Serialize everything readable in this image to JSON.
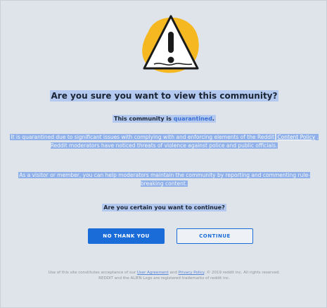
{
  "warning": {
    "icon": "warning-triangle-icon",
    "colors": {
      "blob": "#f5b820",
      "triangle_fill": "#ffffff",
      "mark": "#1a1a1a"
    }
  },
  "dialog": {
    "title": "Are you sure you want to view this community?",
    "subtitle_prefix": "This community is",
    "subtitle_status": "quarantined",
    "subtitle_suffix": ".",
    "para1_start": "It is quarantined due to significant issues with complying with and enforcing elements of the Reddit",
    "para1_link": "Content Policy",
    "para1_end": ". Reddit moderators have noticed threats of violence against police and public officials.",
    "para2": "As a visitor or member, you can help moderators maintain the community by reporting and commenting rule-breaking content.",
    "question": "Are you certain you want to continue?"
  },
  "buttons": {
    "no_label": "NO THANK YOU",
    "continue_label": "CONTINUE"
  },
  "footer": {
    "text_start": "Use of this site constitutes acceptance of our",
    "user_agreement": "User Agreement",
    "and": "and",
    "privacy_policy": "Privacy Policy",
    "text_end": ". © 2019 reddit inc. All rights reserved. REDDIT and the ALIEN Logo are registered trademarks of reddit inc."
  },
  "colors": {
    "background": "#dfe4ea",
    "accent": "#1a6dd8",
    "selection": "#8fb0e8"
  }
}
